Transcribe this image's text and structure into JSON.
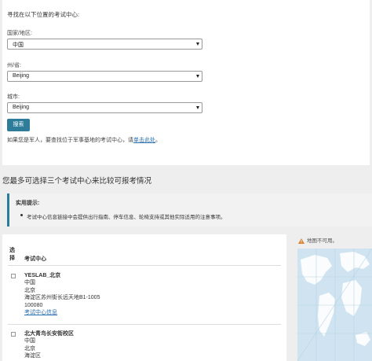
{
  "search": {
    "intro": "寻找在以下位置的考试中心:",
    "country_label": "国家/地区:",
    "country_value": "中国",
    "state_label": "州/省:",
    "state_value": "Beijing",
    "city_label": "城市:",
    "city_value": "Beijing",
    "search_button": "搜索",
    "military_text": "如果您是军人，要查找位于军事基地的考试中心，请",
    "military_link": "单击此处",
    "military_end": "。"
  },
  "compare": {
    "title": "您最多可选择三个考试中心来比较可报考情况"
  },
  "tip": {
    "title": "实用提示:",
    "items": [
      "考试中心信息链接中会提供出行指南、停车信息、轮椅支持或其他实际适用的注意事项。"
    ]
  },
  "table": {
    "select_header": "选择",
    "center_header": "考试中心",
    "centers": [
      {
        "name": "YESLAB_北京",
        "lines": [
          "中国",
          "北京",
          "海淀区苏州街长远天地B1-1005",
          "100080"
        ],
        "link": "考试中心信息"
      },
      {
        "name": "北大青鸟长安街校区",
        "lines": [
          "中国",
          "北京",
          "海淀区"
        ],
        "link": ""
      }
    ]
  },
  "map": {
    "error_text": "地图不可用。",
    "warning_icon": "warning-triangle-icon",
    "warning_color": "#d9822b",
    "image_icon": "world-map-image"
  },
  "colors": {
    "primary": "#2d7d9a",
    "link": "#2a6fb0",
    "page_bg": "#eeeeee"
  }
}
